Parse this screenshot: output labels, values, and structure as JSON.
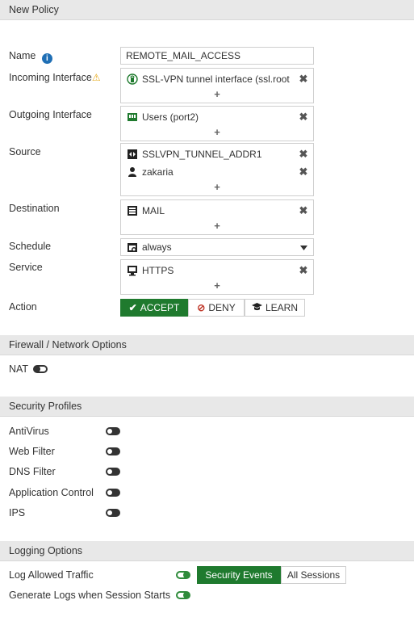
{
  "header": {
    "title": "New Policy"
  },
  "fields": {
    "name_label": "Name",
    "name_value": "REMOTE_MAIL_ACCESS",
    "incoming_label": "Incoming Interface",
    "incoming_items": [
      "SSL-VPN tunnel interface (ssl.root"
    ],
    "outgoing_label": "Outgoing Interface",
    "outgoing_items": [
      "Users (port2)"
    ],
    "source_label": "Source",
    "source_items": [
      "SSLVPN_TUNNEL_ADDR1",
      "zakaria"
    ],
    "destination_label": "Destination",
    "destination_items": [
      "MAIL"
    ],
    "schedule_label": "Schedule",
    "schedule_value": "always",
    "service_label": "Service",
    "service_items": [
      "HTTPS"
    ],
    "action_label": "Action",
    "action_buttons": [
      "ACCEPT",
      "DENY",
      "LEARN"
    ],
    "add_symbol": "+",
    "remove_symbol": "✖"
  },
  "firewall": {
    "title": "Firewall / Network Options",
    "nat_label": "NAT"
  },
  "security": {
    "title": "Security Profiles",
    "items": [
      "AntiVirus",
      "Web Filter",
      "DNS Filter",
      "Application Control",
      "IPS"
    ]
  },
  "logging": {
    "title": "Logging Options",
    "log_allowed_label": "Log Allowed Traffic",
    "log_options": [
      "Security Events",
      "All Sessions"
    ],
    "log_start_label": "Generate Logs when Session Starts"
  },
  "colors": {
    "accent_green": "#1f7a2e",
    "deny_red": "#c0392b",
    "info_blue": "#1f6fb5",
    "warn_yellow": "#e6a817"
  },
  "icons": {
    "name_info": "info-circle-icon",
    "incoming_warning": "warning-icon",
    "incoming_item": "ssl-vpn-tunnel-icon",
    "outgoing_item": "network-port-icon",
    "source_address": "address-icon",
    "source_user": "user-icon",
    "destination_item": "server-address-icon",
    "schedule_item": "schedule-icon",
    "service_item": "service-icon",
    "accept": "checkmark-icon",
    "deny": "deny-circle-icon",
    "learn": "graduation-cap-icon"
  },
  "states": {
    "action_selected": "ACCEPT",
    "nat": false,
    "antivirus": false,
    "web_filter": false,
    "dns_filter": false,
    "application_control": false,
    "ips": false,
    "log_allowed_traffic": true,
    "log_mode_selected": "Security Events",
    "generate_logs_session_start": true
  }
}
